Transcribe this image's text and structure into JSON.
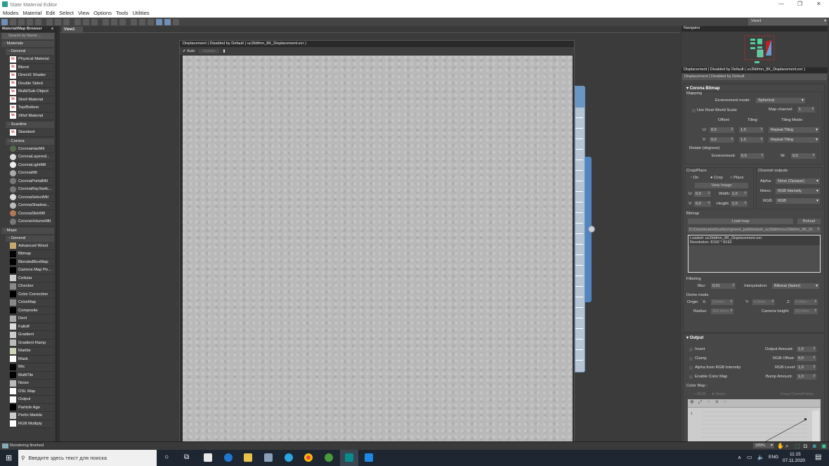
{
  "window": {
    "title": "Slate Material Editor",
    "minimize": "—",
    "maximize": "❐",
    "close": "✕"
  },
  "menu": [
    "Modes",
    "Material",
    "Edit",
    "Select",
    "View",
    "Options",
    "Tools",
    "Utilities"
  ],
  "browser": {
    "title": "Material/Map Browser",
    "close": "x",
    "search_placeholder": "Search by Name ...",
    "materials_label": "- Materials",
    "general_label": "- General",
    "general": [
      "Physical Material",
      "Blend",
      "DirectX Shader",
      "Double Sided",
      "Multi/Sub-Object",
      "Shell Material",
      "Top/Bottom",
      "XRef Material"
    ],
    "scanline_label": "- Scanline",
    "scanline": [
      "Standard"
    ],
    "corona_label": "- Corona",
    "corona": [
      {
        "name": "CoronaHairMtl",
        "color": "#556b4a"
      },
      {
        "name": "CoronaLayered...",
        "color": "#ddd"
      },
      {
        "name": "CoronaLightMtl",
        "color": "#eee"
      },
      {
        "name": "CoronaMtl",
        "color": "#aaa"
      },
      {
        "name": "CoronaPortalMtl",
        "color": "#777"
      },
      {
        "name": "CoronaRaySwitc...",
        "color": "#777"
      },
      {
        "name": "CoronaSelectMtl",
        "color": "#ddd"
      },
      {
        "name": "CoronaShadow...",
        "color": "#bbb"
      },
      {
        "name": "CoronaSkinMtl",
        "color": "#b07a55"
      },
      {
        "name": "CoronaVolumeMtl",
        "color": "#777"
      }
    ],
    "maps_label": "- Maps",
    "maps_general_label": "- General",
    "maps": [
      {
        "name": "Advanced Wood",
        "color": "#c8a870"
      },
      {
        "name": "Bitmap",
        "color": "#000"
      },
      {
        "name": "BlendedBoxMap",
        "color": "#000"
      },
      {
        "name": "Camera Map Pe...",
        "color": "#000"
      },
      {
        "name": "Cellular",
        "color": "#ccc"
      },
      {
        "name": "Checker",
        "color": "#888"
      },
      {
        "name": "Color Correction",
        "color": "#000"
      },
      {
        "name": "ColorMap",
        "color": "#888"
      },
      {
        "name": "Composite",
        "color": "#000"
      },
      {
        "name": "Dent",
        "color": "#aaa"
      },
      {
        "name": "Falloff",
        "color": "#ddd"
      },
      {
        "name": "Gradient",
        "color": "#ccc"
      },
      {
        "name": "Gradient Ramp",
        "color": "#bbb"
      },
      {
        "name": "Marble",
        "color": "#cdd6b8"
      },
      {
        "name": "Mask",
        "color": "#fff"
      },
      {
        "name": "Mix",
        "color": "#000"
      },
      {
        "name": "MultiTile",
        "color": "#000"
      },
      {
        "name": "Noise",
        "color": "#bbb"
      },
      {
        "name": "OSL Map",
        "color": "#fff"
      },
      {
        "name": "Output",
        "color": "#fff"
      },
      {
        "name": "Particle Age",
        "color": "#000"
      },
      {
        "name": "Perlin Marble",
        "color": "#ccc"
      },
      {
        "name": "RGB Multiply",
        "color": "#fff"
      }
    ]
  },
  "view": {
    "tab": "View1",
    "selector": "View1"
  },
  "dispwin": {
    "title": "Displacement | Disabled by Default ( uc2kbfmn_8K_Displacement.exr )",
    "auto": "Auto",
    "update": "Update"
  },
  "navigator": {
    "title": "Navigator"
  },
  "params": {
    "title": "Displacement | Disabled by Default ( uc2kbfmn_8K_Displacement.exr )",
    "name": "Displacement | Disabled by Default",
    "rollout": "Corona Bitmap",
    "mapping": "Mapping",
    "env_mode_label": "Environment mode:",
    "env_mode": "Spherical",
    "real_world": "Use Real-World Scale",
    "map_channel_label": "Map channel:",
    "map_channel": "1",
    "offset": "Offset:",
    "tiling": "Tiling:",
    "tiling_mode": "Tiling Mode:",
    "u": "U:",
    "v": "V:",
    "u_offset": "0,0",
    "u_tiling": "1,0",
    "u_mode": "Repeat Tiling",
    "v_offset": "0,0",
    "v_tiling": "1,0",
    "v_mode": "Repeat Tiling",
    "rotate": "Rotate (degrees)",
    "environment_label": "Environment:",
    "environment": "0,0",
    "w_label": "W:",
    "w": "0,0",
    "crop": "Crop/Place",
    "on": "On",
    "crop_opt": "Crop",
    "place": "Place",
    "view_image": "View Image",
    "cu": "0,0",
    "cv": "0,0",
    "width_label": "Width:",
    "width": "1,0",
    "height_label": "Height:",
    "height": "1,0",
    "channel_outputs": "Channel outputs",
    "alpha_label": "Alpha:",
    "alpha": "None (Opaque)",
    "mono_label": "Mono:",
    "mono": "RGB Intensity",
    "rgb_label": "RGB:",
    "rgb": "RGB",
    "bitmap": "Bitmap",
    "load_map": "Load map",
    "reload": "Reload",
    "path": "D:\\Downloaded\\surface\\gravel_pebbledash_uc2kbfmn\\uc2kbfmn_8K_Di",
    "info1": "Loaded: uc2kbfmn_8K_Displacement.exr",
    "info2": "Resolution: 8192 * 8192",
    "filtering": "Filtering",
    "blur_label": "Blur:",
    "blur": "0,01",
    "interp_label": "Interpolation:",
    "interp": "Bilinear (faster)",
    "dome": "Dome mode",
    "origin": "Origin",
    "x_label": "X:",
    "x": "0,0mm",
    "y_label": "Y:",
    "y": "0,0mm",
    "z_label": "Z:",
    "z": "0,0mm",
    "radius_label": "Radius:",
    "radius": "200,0mm",
    "cam_label": "Camera height:",
    "cam": "20,0mm",
    "output": "Output",
    "invert": "Invert",
    "clamp": "Clamp",
    "alpha_rgb": "Alpha from RGB Intensity",
    "enable_cm": "Enable Color Map",
    "out_amount_label": "Output Amount:",
    "out_amount": "1,0",
    "rgb_offset_label": "RGB Offset:",
    "rgb_offset": "0,0",
    "rgb_level_label": "RGB Level:",
    "rgb_level": "1,0",
    "bump_label": "Bump Amount:",
    "bump": "1,0",
    "color_map": "Color Map :",
    "cm_rgb": "RGB",
    "cm_mono": "Mono",
    "copy_cp": "Copy CurvePoints",
    "curve_val": "1"
  },
  "status": {
    "text": "Rendering finished",
    "zoom": "189%"
  },
  "taskbar": {
    "search": "Введите здесь текст для поиска",
    "lang": "ENG",
    "time": "11:15",
    "date": "07.11.2020"
  }
}
